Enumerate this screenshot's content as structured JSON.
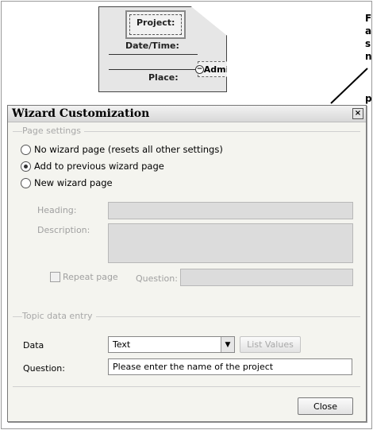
{
  "card": {
    "project_label": "Project:",
    "datetime_label": "Date/Time:",
    "place_label": "Place:",
    "admin_label": "Admin",
    "minus_glyph": "−"
  },
  "side_text": [
    "F",
    "a",
    "s",
    "n",
    "p"
  ],
  "dialog": {
    "title": "Wizard Customization",
    "close_glyph": "×",
    "page_settings": {
      "section_label": "Page settings",
      "options": [
        {
          "label": "No wizard page (resets all other settings)",
          "checked": false
        },
        {
          "label": "Add to previous wizard page",
          "checked": true
        },
        {
          "label": "New wizard page",
          "checked": false
        }
      ],
      "heading_label": "Heading:",
      "heading_value": "",
      "description_label": "Description:",
      "description_value": "",
      "repeat_label": "Repeat page",
      "question_label": "Question:",
      "question_value": ""
    },
    "topic_data": {
      "section_label": "Topic data entry",
      "data_label": "Data",
      "data_value": "Text",
      "dropdown_glyph": "▼",
      "list_values_label": "List Values",
      "question_label": "Question:",
      "question_value": "Please enter the name of the project"
    },
    "close_label": "Close"
  }
}
